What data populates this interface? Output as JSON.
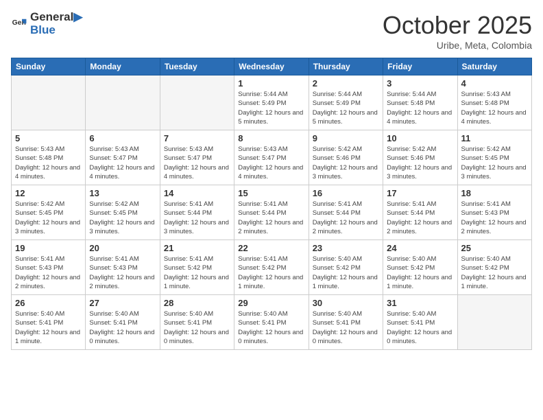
{
  "header": {
    "logo_general": "General",
    "logo_blue": "Blue",
    "month": "October 2025",
    "location": "Uribe, Meta, Colombia"
  },
  "weekdays": [
    "Sunday",
    "Monday",
    "Tuesday",
    "Wednesday",
    "Thursday",
    "Friday",
    "Saturday"
  ],
  "weeks": [
    [
      {
        "day": "",
        "empty": true
      },
      {
        "day": "",
        "empty": true
      },
      {
        "day": "",
        "empty": true
      },
      {
        "day": "1",
        "sunrise": "5:44 AM",
        "sunset": "5:49 PM",
        "daylight": "12 hours and 5 minutes."
      },
      {
        "day": "2",
        "sunrise": "5:44 AM",
        "sunset": "5:49 PM",
        "daylight": "12 hours and 5 minutes."
      },
      {
        "day": "3",
        "sunrise": "5:44 AM",
        "sunset": "5:48 PM",
        "daylight": "12 hours and 4 minutes."
      },
      {
        "day": "4",
        "sunrise": "5:43 AM",
        "sunset": "5:48 PM",
        "daylight": "12 hours and 4 minutes."
      }
    ],
    [
      {
        "day": "5",
        "sunrise": "5:43 AM",
        "sunset": "5:48 PM",
        "daylight": "12 hours and 4 minutes."
      },
      {
        "day": "6",
        "sunrise": "5:43 AM",
        "sunset": "5:47 PM",
        "daylight": "12 hours and 4 minutes."
      },
      {
        "day": "7",
        "sunrise": "5:43 AM",
        "sunset": "5:47 PM",
        "daylight": "12 hours and 4 minutes."
      },
      {
        "day": "8",
        "sunrise": "5:43 AM",
        "sunset": "5:47 PM",
        "daylight": "12 hours and 4 minutes."
      },
      {
        "day": "9",
        "sunrise": "5:42 AM",
        "sunset": "5:46 PM",
        "daylight": "12 hours and 3 minutes."
      },
      {
        "day": "10",
        "sunrise": "5:42 AM",
        "sunset": "5:46 PM",
        "daylight": "12 hours and 3 minutes."
      },
      {
        "day": "11",
        "sunrise": "5:42 AM",
        "sunset": "5:45 PM",
        "daylight": "12 hours and 3 minutes."
      }
    ],
    [
      {
        "day": "12",
        "sunrise": "5:42 AM",
        "sunset": "5:45 PM",
        "daylight": "12 hours and 3 minutes."
      },
      {
        "day": "13",
        "sunrise": "5:42 AM",
        "sunset": "5:45 PM",
        "daylight": "12 hours and 3 minutes."
      },
      {
        "day": "14",
        "sunrise": "5:41 AM",
        "sunset": "5:44 PM",
        "daylight": "12 hours and 3 minutes."
      },
      {
        "day": "15",
        "sunrise": "5:41 AM",
        "sunset": "5:44 PM",
        "daylight": "12 hours and 2 minutes."
      },
      {
        "day": "16",
        "sunrise": "5:41 AM",
        "sunset": "5:44 PM",
        "daylight": "12 hours and 2 minutes."
      },
      {
        "day": "17",
        "sunrise": "5:41 AM",
        "sunset": "5:44 PM",
        "daylight": "12 hours and 2 minutes."
      },
      {
        "day": "18",
        "sunrise": "5:41 AM",
        "sunset": "5:43 PM",
        "daylight": "12 hours and 2 minutes."
      }
    ],
    [
      {
        "day": "19",
        "sunrise": "5:41 AM",
        "sunset": "5:43 PM",
        "daylight": "12 hours and 2 minutes."
      },
      {
        "day": "20",
        "sunrise": "5:41 AM",
        "sunset": "5:43 PM",
        "daylight": "12 hours and 2 minutes."
      },
      {
        "day": "21",
        "sunrise": "5:41 AM",
        "sunset": "5:42 PM",
        "daylight": "12 hours and 1 minute."
      },
      {
        "day": "22",
        "sunrise": "5:41 AM",
        "sunset": "5:42 PM",
        "daylight": "12 hours and 1 minute."
      },
      {
        "day": "23",
        "sunrise": "5:40 AM",
        "sunset": "5:42 PM",
        "daylight": "12 hours and 1 minute."
      },
      {
        "day": "24",
        "sunrise": "5:40 AM",
        "sunset": "5:42 PM",
        "daylight": "12 hours and 1 minute."
      },
      {
        "day": "25",
        "sunrise": "5:40 AM",
        "sunset": "5:42 PM",
        "daylight": "12 hours and 1 minute."
      }
    ],
    [
      {
        "day": "26",
        "sunrise": "5:40 AM",
        "sunset": "5:41 PM",
        "daylight": "12 hours and 1 minute."
      },
      {
        "day": "27",
        "sunrise": "5:40 AM",
        "sunset": "5:41 PM",
        "daylight": "12 hours and 0 minutes."
      },
      {
        "day": "28",
        "sunrise": "5:40 AM",
        "sunset": "5:41 PM",
        "daylight": "12 hours and 0 minutes."
      },
      {
        "day": "29",
        "sunrise": "5:40 AM",
        "sunset": "5:41 PM",
        "daylight": "12 hours and 0 minutes."
      },
      {
        "day": "30",
        "sunrise": "5:40 AM",
        "sunset": "5:41 PM",
        "daylight": "12 hours and 0 minutes."
      },
      {
        "day": "31",
        "sunrise": "5:40 AM",
        "sunset": "5:41 PM",
        "daylight": "12 hours and 0 minutes."
      },
      {
        "day": "",
        "empty": true
      }
    ]
  ]
}
